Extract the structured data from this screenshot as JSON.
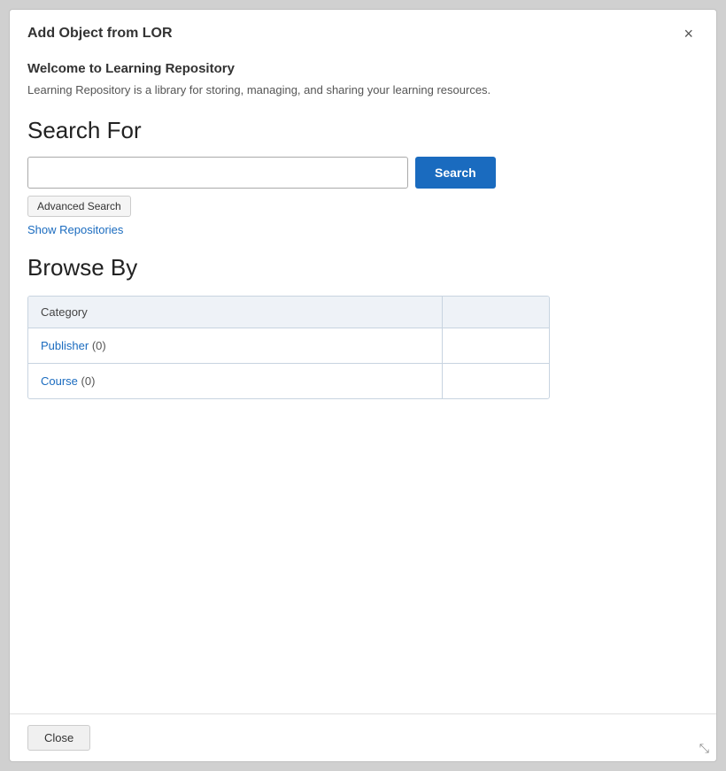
{
  "dialog": {
    "title": "Add Object from LOR",
    "close_label": "×"
  },
  "welcome": {
    "heading": "Welcome to Learning Repository",
    "description": "Learning Repository is a library for storing, managing, and sharing your learning resources."
  },
  "search": {
    "section_heading": "Search For",
    "input_placeholder": "",
    "input_value": "",
    "search_button_label": "Search",
    "advanced_search_label": "Advanced Search",
    "show_repositories_label": "Show Repositories"
  },
  "browse": {
    "section_heading": "Browse By",
    "table": {
      "header": {
        "category_col": "Category",
        "value_col": ""
      },
      "rows": [
        {
          "name": "Publisher",
          "count": "(0)",
          "value": ""
        },
        {
          "name": "Course",
          "count": "(0)",
          "value": ""
        }
      ]
    }
  },
  "footer": {
    "close_button_label": "Close"
  },
  "icons": {
    "close": "×",
    "resize": "⤡"
  }
}
